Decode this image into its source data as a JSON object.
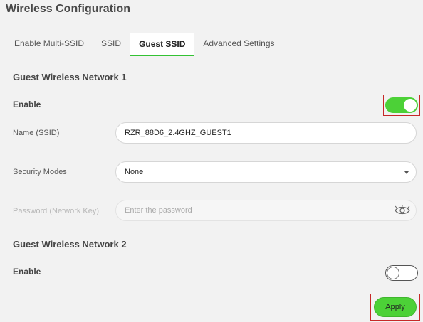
{
  "page": {
    "title": "Wireless Configuration"
  },
  "tabs": [
    {
      "label": "Enable Multi-SSID",
      "active": false
    },
    {
      "label": "SSID",
      "active": false
    },
    {
      "label": "Guest SSID",
      "active": true
    },
    {
      "label": "Advanced Settings",
      "active": false
    }
  ],
  "network1": {
    "title": "Guest Wireless Network 1",
    "enable_label": "Enable",
    "enabled": true,
    "name_label": "Name (SSID)",
    "name_value": "RZR_88D6_2.4GHZ_GUEST1",
    "security_label": "Security Modes",
    "security_value": "None",
    "password_label": "Password (Network Key)",
    "password_placeholder": "Enter the password",
    "password_value": ""
  },
  "network2": {
    "title": "Guest Wireless Network 2",
    "enable_label": "Enable",
    "enabled": false
  },
  "actions": {
    "apply_label": "Apply"
  },
  "colors": {
    "accent": "#4cd137",
    "highlight": "#c62828",
    "background": "#f2f2f2"
  },
  "icons": {
    "password_visibility": "eye-icon",
    "dropdown": "chevron-down-icon"
  }
}
